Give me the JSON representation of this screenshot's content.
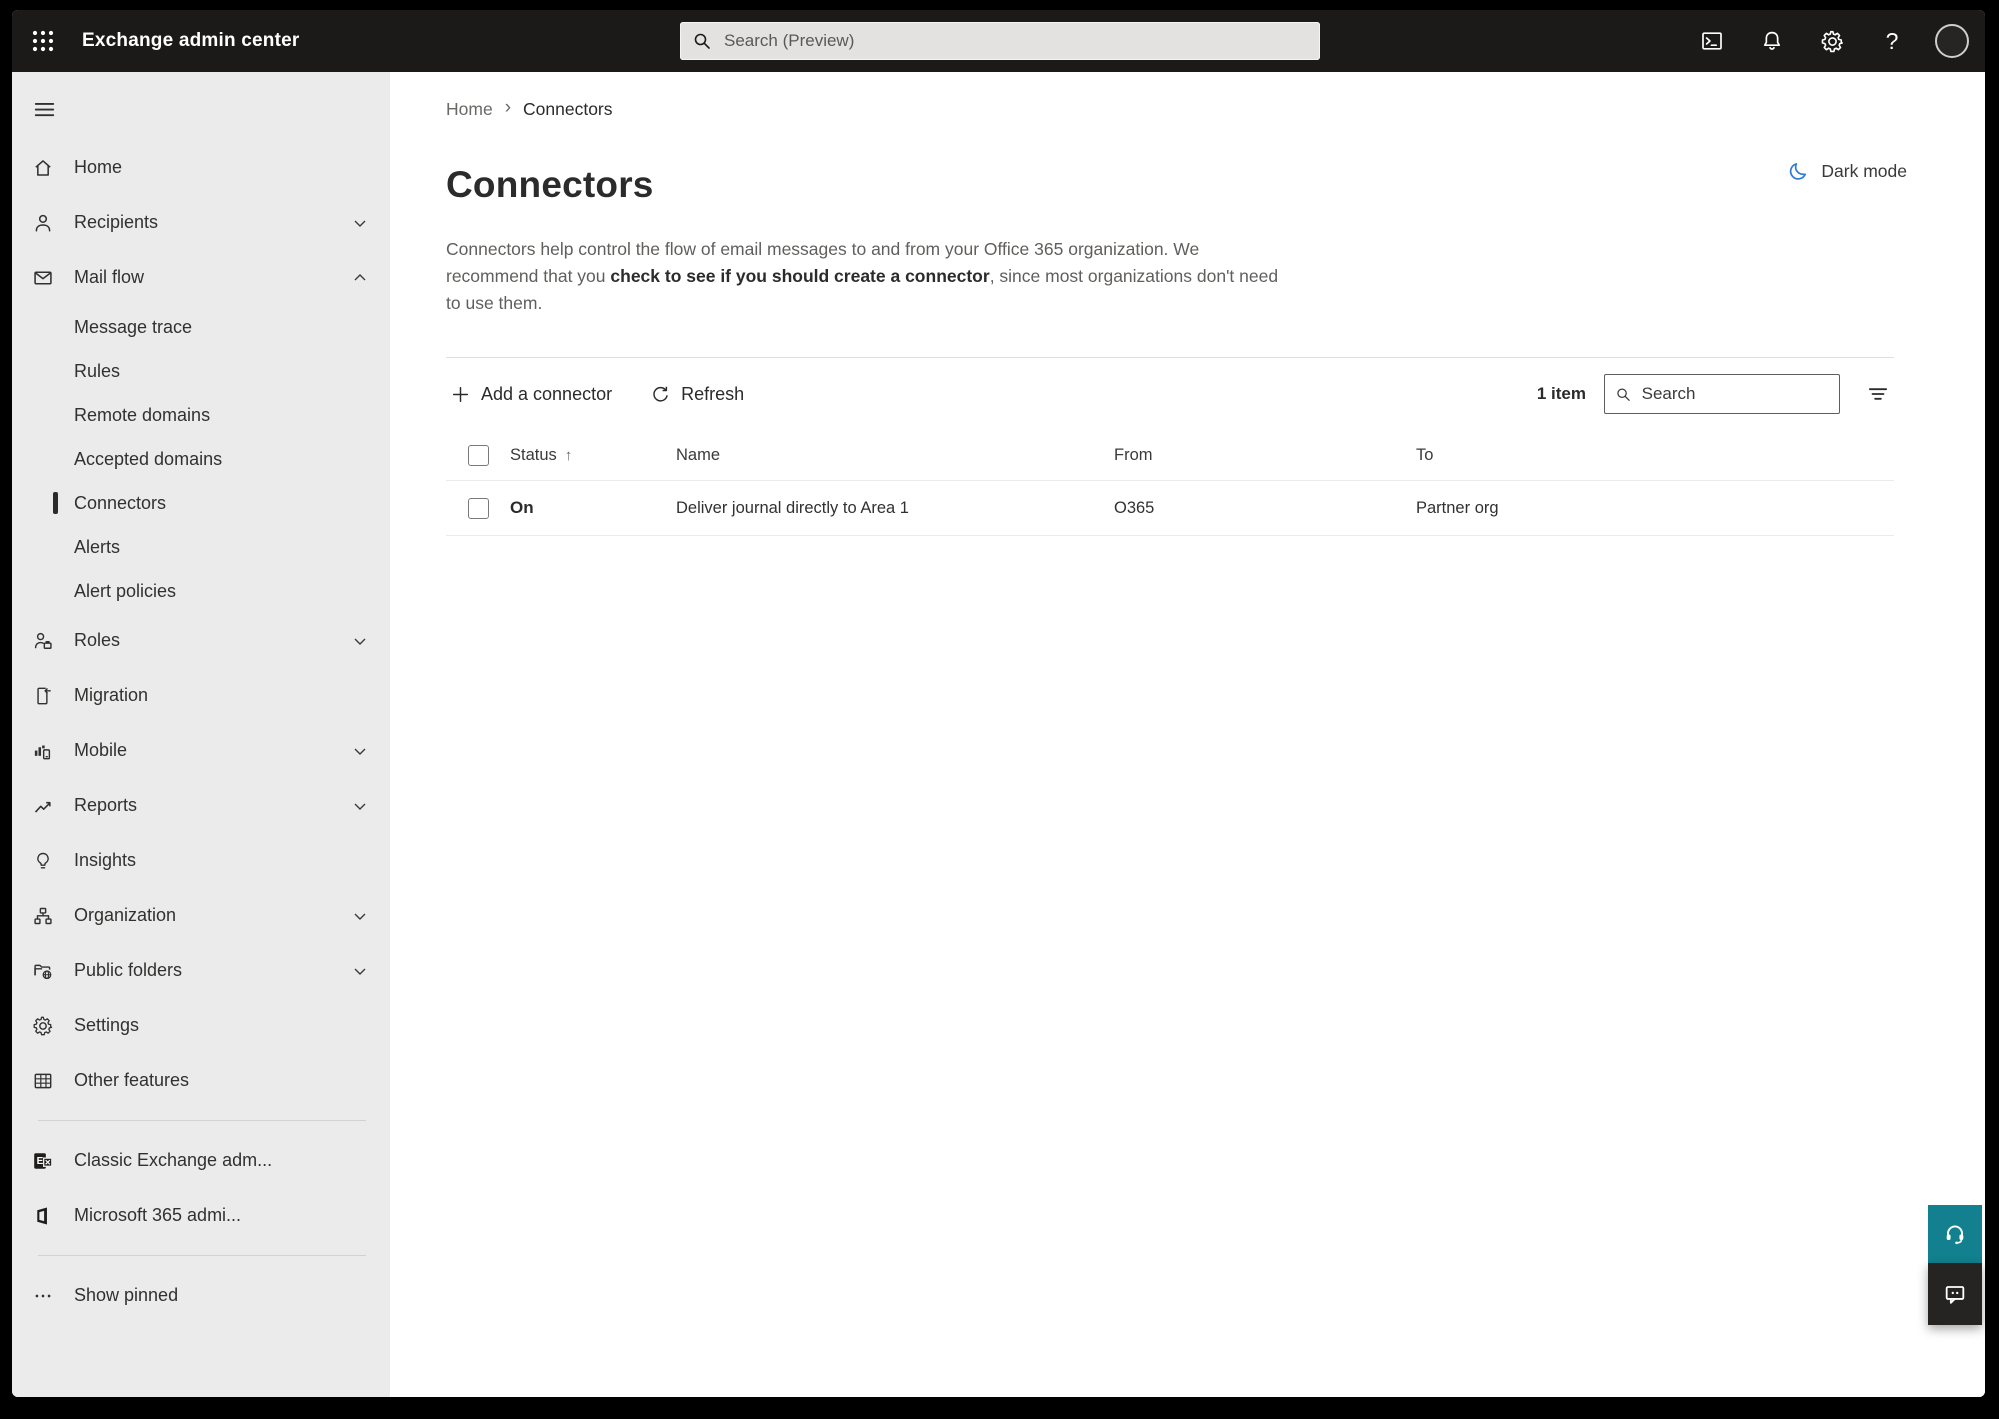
{
  "topbar": {
    "app_title": "Exchange admin center",
    "search_placeholder": "Search (Preview)"
  },
  "breadcrumb": {
    "home": "Home",
    "current": "Connectors"
  },
  "theme_toggle": {
    "label": "Dark mode"
  },
  "page": {
    "title": "Connectors",
    "intro_pre": "Connectors help control the flow of email messages to and from your Office 365 organization. We recommend that you ",
    "intro_emph": "check to see if you should create a connector",
    "intro_post": ", since most organizations don't need to use them."
  },
  "toolbar": {
    "add_label": "Add a connector",
    "refresh_label": "Refresh",
    "item_count": "1 item",
    "search_placeholder": "Search"
  },
  "table": {
    "headers": {
      "status": "Status",
      "name": "Name",
      "from": "From",
      "to": "To"
    },
    "rows": [
      {
        "status": "On",
        "name": "Deliver journal directly to Area 1",
        "from": "O365",
        "to": "Partner org"
      }
    ]
  },
  "sidebar": {
    "items": [
      {
        "label": "Home"
      },
      {
        "label": "Recipients"
      },
      {
        "label": "Mail flow",
        "children": [
          {
            "label": "Message trace"
          },
          {
            "label": "Rules"
          },
          {
            "label": "Remote domains"
          },
          {
            "label": "Accepted domains"
          },
          {
            "label": "Connectors",
            "selected": true
          },
          {
            "label": "Alerts"
          },
          {
            "label": "Alert policies"
          }
        ]
      },
      {
        "label": "Roles"
      },
      {
        "label": "Migration"
      },
      {
        "label": "Mobile"
      },
      {
        "label": "Reports"
      },
      {
        "label": "Insights"
      },
      {
        "label": "Organization"
      },
      {
        "label": "Public folders"
      },
      {
        "label": "Settings"
      },
      {
        "label": "Other features"
      }
    ],
    "footer": [
      {
        "label": "Classic Exchange adm..."
      },
      {
        "label": "Microsoft 365 admi..."
      },
      {
        "label": "Show pinned"
      }
    ]
  },
  "colors": {
    "topbar_bg": "#1b1a19",
    "sidebar_bg": "#ebebeb",
    "accent_teal": "#12808e",
    "moon_blue": "#2e7cd6",
    "selected_indicator": "#2b2b2b"
  }
}
